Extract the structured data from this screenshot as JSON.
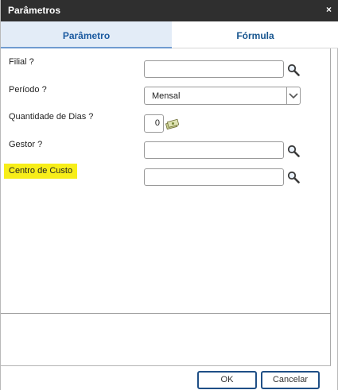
{
  "window": {
    "title": "Parâmetros",
    "close_glyph": "×"
  },
  "tabs": [
    {
      "label": "Parâmetro",
      "active": true
    },
    {
      "label": "Fórmula",
      "active": false
    }
  ],
  "fields": {
    "filial": {
      "label": "Filial ?",
      "value": ""
    },
    "periodo": {
      "label": "Período ?",
      "value": "Mensal"
    },
    "dias": {
      "label": "Quantidade de Dias ?",
      "value": "0"
    },
    "gestor": {
      "label": "Gestor ?",
      "value": ""
    },
    "centro": {
      "label": "Centro de Custo",
      "value": "",
      "highlight_color": "#f7ee19"
    }
  },
  "buttons": {
    "ok": "OK",
    "cancel": "Cancelar"
  },
  "icons": {
    "search": "search-icon",
    "money": "money-icon",
    "dropdown": "chevron-down-icon",
    "close": "close-icon"
  },
  "colors": {
    "titlebar": "#2f2f2f",
    "tab_active_bg": "#e3ecf7",
    "tab_text": "#1b5aa0",
    "button_border": "#1f4f86",
    "highlight": "#f7ee19"
  }
}
